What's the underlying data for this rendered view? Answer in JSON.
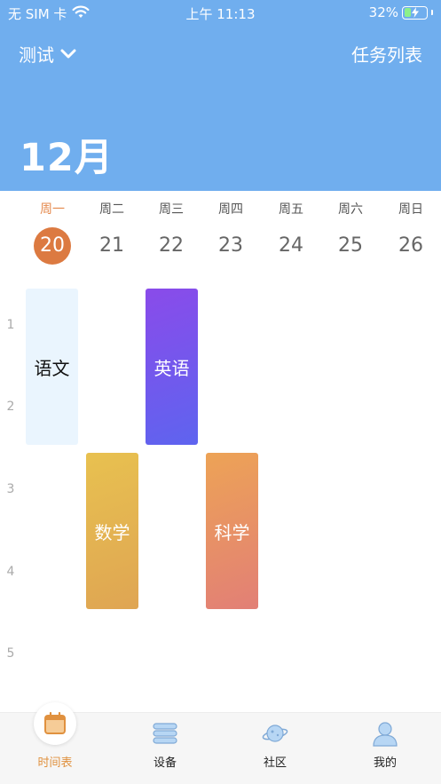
{
  "status_bar": {
    "carrier": "无 SIM 卡",
    "time": "上午 11:13",
    "battery": "32%",
    "battery_level": 0.32
  },
  "header": {
    "dropdown_label": "测试",
    "task_list_label": "任务列表",
    "month": "12月",
    "background_color": "#70AEEE"
  },
  "week": {
    "days": [
      {
        "weekday": "周一",
        "date": "20",
        "selected": true
      },
      {
        "weekday": "周二",
        "date": "21",
        "selected": false
      },
      {
        "weekday": "周三",
        "date": "22",
        "selected": false
      },
      {
        "weekday": "周四",
        "date": "23",
        "selected": false
      },
      {
        "weekday": "周五",
        "date": "24",
        "selected": false
      },
      {
        "weekday": "周六",
        "date": "25",
        "selected": false
      },
      {
        "weekday": "周日",
        "date": "26",
        "selected": false
      }
    ]
  },
  "timetable": {
    "periods": [
      "1",
      "2",
      "3",
      "4",
      "5"
    ],
    "courses": [
      {
        "name": "语文",
        "day": "周一",
        "periods": [
          "1",
          "2"
        ],
        "color": "#EAF5FE"
      },
      {
        "name": "英语",
        "day": "周三",
        "periods": [
          "1",
          "2"
        ],
        "color": "#6F58EC"
      },
      {
        "name": "数学",
        "day": "周二",
        "periods": [
          "3",
          "4"
        ],
        "color": "#E3B352"
      },
      {
        "name": "科学",
        "day": "周四",
        "periods": [
          "3",
          "4"
        ],
        "color": "#E89166"
      }
    ]
  },
  "tabbar": {
    "tabs": [
      {
        "label": "时间表",
        "icon": "calendar-icon",
        "active": true
      },
      {
        "label": "设备",
        "icon": "device-stack-icon",
        "active": false
      },
      {
        "label": "社区",
        "icon": "planet-icon",
        "active": false
      },
      {
        "label": "我的",
        "icon": "user-icon",
        "active": false
      }
    ],
    "active_color": "#E0913F"
  }
}
